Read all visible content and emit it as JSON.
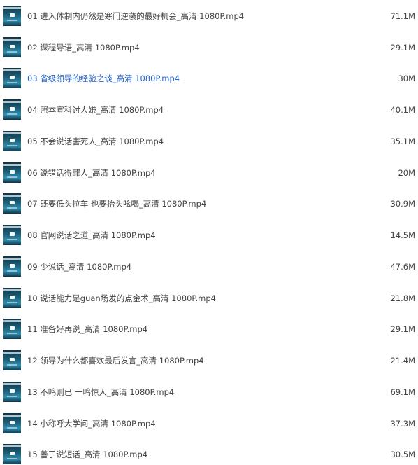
{
  "files": [
    {
      "name": "01 进入体制内仍然是寒门逆袭的最好机会_高清 1080P.mp4",
      "size": "71.1M",
      "icon": "video-thumbnail-icon"
    },
    {
      "name": "02 课程导语_高清 1080P.mp4",
      "size": "29.1M",
      "icon": "video-thumbnail-icon"
    },
    {
      "name": "03 省级领导的经验之谈_高清 1080P.mp4",
      "size": "30M",
      "icon": "video-thumbnail-icon",
      "selected": true
    },
    {
      "name": "04 照本宣科讨人嫌_高清 1080P.mp4",
      "size": "40.1M",
      "icon": "video-thumbnail-icon"
    },
    {
      "name": "05 不会说话害死人_高清 1080P.mp4",
      "size": "35.1M",
      "icon": "video-thumbnail-icon"
    },
    {
      "name": "06 说错话得罪人_高清 1080P.mp4",
      "size": "20M",
      "icon": "video-thumbnail-icon"
    },
    {
      "name": "07 既要低头拉车 也要抬头吆喝_高清 1080P.mp4",
      "size": "30.9M",
      "icon": "video-thumbnail-icon"
    },
    {
      "name": "08 官网说话之道_高清 1080P.mp4",
      "size": "14.5M",
      "icon": "video-thumbnail-icon"
    },
    {
      "name": "09 少说话_高清 1080P.mp4",
      "size": "47.6M",
      "icon": "video-thumbnail-icon"
    },
    {
      "name": "10 说话能力是guan场发的点金术_高清 1080P.mp4",
      "size": "21.8M",
      "icon": "video-thumbnail-icon"
    },
    {
      "name": "11 准备好再说_高清 1080P.mp4",
      "size": "29.1M",
      "icon": "video-thumbnail-icon"
    },
    {
      "name": "12 领导为什么都喜欢最后发言_高清 1080P.mp4",
      "size": "21.4M",
      "icon": "video-thumbnail-icon"
    },
    {
      "name": "13 不鸣则已 一鸣惊人_高清 1080P.mp4",
      "size": "69.1M",
      "icon": "video-thumbnail-icon"
    },
    {
      "name": "14 小称呼大学问_高清 1080P.mp4",
      "size": "37.3M",
      "icon": "video-thumbnail-icon"
    },
    {
      "name": "15 善于说短话_高清 1080P.mp4",
      "size": "30.5M",
      "icon": "video-thumbnail-icon"
    }
  ],
  "colors": {
    "text": "#424242",
    "selected_text": "#2563cc",
    "background": "#ffffff"
  }
}
